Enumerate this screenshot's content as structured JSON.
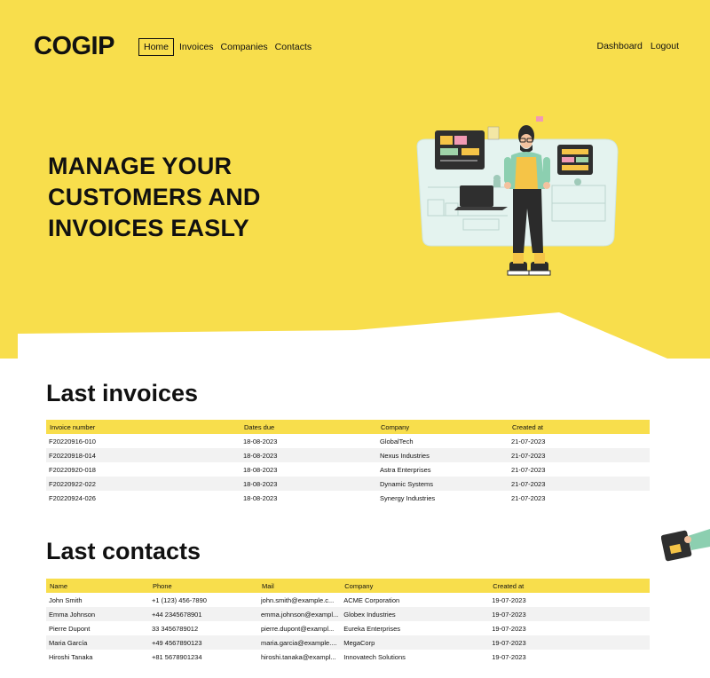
{
  "brand": {
    "logo": "COGIP"
  },
  "nav": {
    "items": [
      {
        "label": "Home",
        "active": true
      },
      {
        "label": "Invoices",
        "active": false
      },
      {
        "label": "Companies",
        "active": false
      },
      {
        "label": "Contacts",
        "active": false
      }
    ],
    "right": {
      "dashboard": "Dashboard",
      "logout": "Logout"
    }
  },
  "hero": {
    "line1": "MANAGE YOUR",
    "line2": "CUSTOMERS AND",
    "line3": "INVOICES EASLY"
  },
  "colors": {
    "accent": "#f8de4c",
    "dark": "#111111",
    "alt_row": "#f2f2f2"
  },
  "invoices": {
    "title": "Last invoices",
    "headers": [
      "Invoice number",
      "Dates due",
      "Company",
      "Created at"
    ],
    "rows": [
      [
        "F20220916-010",
        "18-08-2023",
        "GlobalTech",
        "21-07-2023"
      ],
      [
        "F20220918-014",
        "18-08-2023",
        "Nexus Industries",
        "21-07-2023"
      ],
      [
        "F20220920-018",
        "18-08-2023",
        "Astra Enterprises",
        "21-07-2023"
      ],
      [
        "F20220922-022",
        "18-08-2023",
        "Dynamic Systems",
        "21-07-2023"
      ],
      [
        "F20220924-026",
        "18-08-2023",
        "Synergy Industries",
        "21-07-2023"
      ]
    ]
  },
  "contacts": {
    "title": "Last contacts",
    "headers": [
      "Name",
      "Phone",
      "Mail",
      "Company",
      "Created at"
    ],
    "rows": [
      [
        "John Smith",
        "+1 (123) 456-7890",
        "john.smith@example.c...",
        "ACME Corporation",
        "19-07-2023"
      ],
      [
        "Emma Johnson",
        "+44 2345678901",
        "emma.johnson@exampl...",
        "Globex Industries",
        "19-07-2023"
      ],
      [
        "Pierre Dupont",
        "33 3456789012",
        "pierre.dupont@exampl...",
        "Eureka Enterprises",
        "19-07-2023"
      ],
      [
        "Maria García",
        "+49 4567890123",
        "maria.garcia@example....",
        "MegaCorp",
        "19-07-2023"
      ],
      [
        "Hiroshi Tanaka",
        "+81 5678901234",
        "hiroshi.tanaka@exampl...",
        "Innovatech Solutions",
        "19-07-2023"
      ]
    ]
  }
}
